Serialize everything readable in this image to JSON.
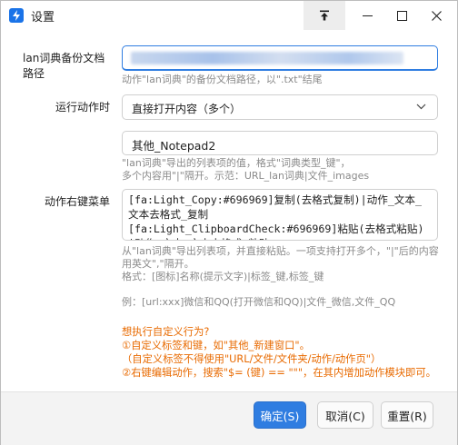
{
  "window": {
    "title": "设置",
    "icons": {
      "app": "bolt-app-icon",
      "pin": "pin-to-top-icon",
      "min": "minimize-icon",
      "max": "maximize-icon",
      "close": "close-icon"
    }
  },
  "form": {
    "backup_path": {
      "label_line1": "lan词典备份文档",
      "label_line2": "路径",
      "value": "",
      "hint": "动作\"lan词典\"的备份文档路径，以\".txt\"结尾"
    },
    "run_action": {
      "label": "运行动作时",
      "selected": "直接打开内容（多个）"
    },
    "other": {
      "value": "其他_Notepad2",
      "hint_line1": "\"lan词典\"导出的列表项的值，格式\"词典类型_键\"，",
      "hint_line2": "多个内容用\"|\"隔开。示范：URL_lan词典|文件_images"
    },
    "context_menu": {
      "label": "动作右键菜单",
      "value": "[fa:Light_Copy:#696969]复制(去格式复制)|动作_文本_文本去格式_复制\n[fa:Light_ClipboardCheck:#696969]粘贴(去格式粘贴)|动作_文本_文本去格式_粘贴",
      "hint_line1": "从\"lan词典\"导出列表项，并直接粘贴。一项支持打开多个，\"|\"后的内容",
      "hint_line2": "用英文\",\"隔开。",
      "hint_line3": "格式：[图标]名称(提示文字)|标签_键,标签_键",
      "hint_line4": "例：[url:xxx]微信和QQ(打开微信和QQ)|文件_微信,文件_QQ"
    },
    "custom": {
      "line1": "想执行自定义行为?",
      "line2": "①自定义标签和键，如\"其他_新建窗口\"。",
      "line3": "（自定义标签不得使用\"URL/文件/文件夹/动作/动作页\"）",
      "line4": "②右键编辑动作，搜索\"$= (键) == \"\"\"，在其内增加动作模块即可。"
    }
  },
  "buttons": {
    "ok": "确定(S)",
    "cancel": "取消(C)",
    "reset": "重置(R)"
  },
  "colors": {
    "primary": "#2f7de1",
    "hint": "#8a8a8a",
    "orange": "#e86a00"
  }
}
